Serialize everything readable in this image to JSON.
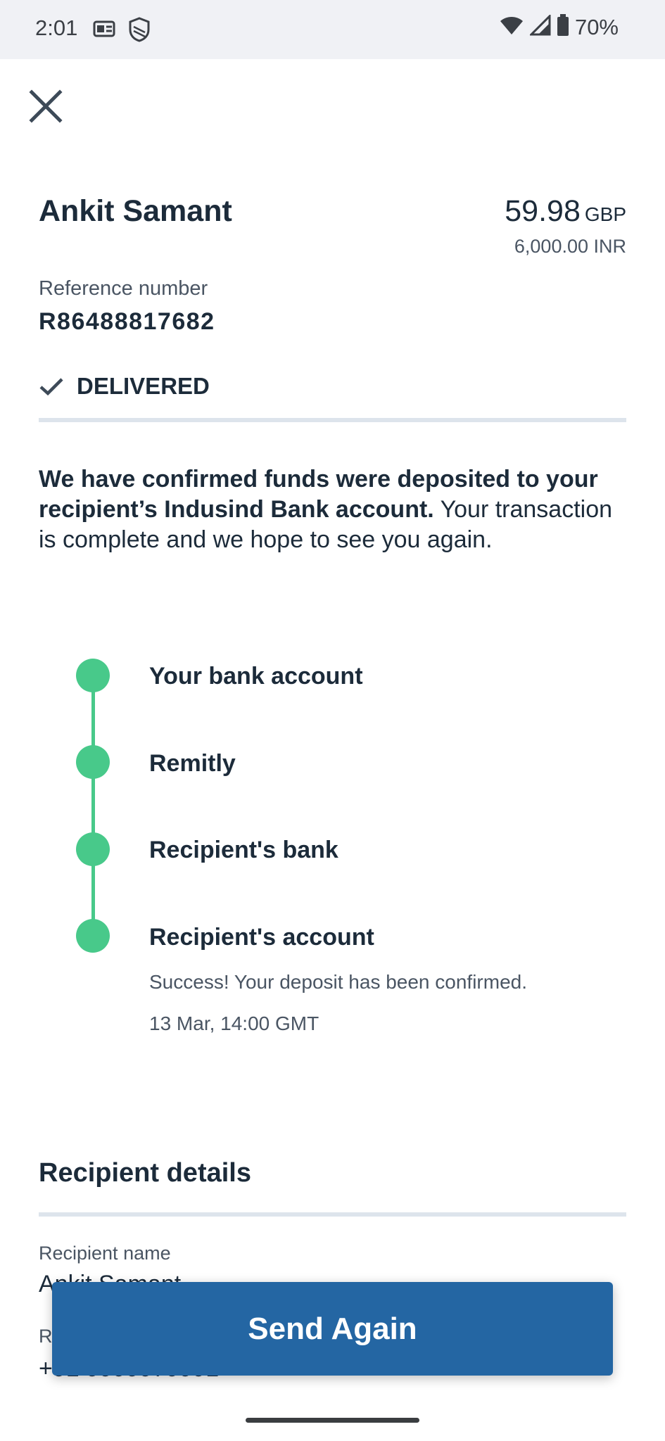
{
  "status_bar": {
    "time": "2:01",
    "battery": "70%"
  },
  "header": {
    "close_icon": "close-icon"
  },
  "transfer": {
    "recipient": "Ankit Samant",
    "amount": "59.98",
    "amount_currency": "GBP",
    "converted": "6,000.00 INR",
    "reference_label": "Reference number",
    "reference_value": "R86488817682",
    "status": "DELIVERED"
  },
  "message": {
    "bold": "We have confirmed funds were deposited to your recipient’s Indusind Bank account.",
    "normal": " Your transaction is complete and we hope to see you again."
  },
  "timeline": {
    "steps": [
      {
        "label": "Your bank account"
      },
      {
        "label": "Remitly"
      },
      {
        "label": "Recipient's bank"
      },
      {
        "label": "Recipient's account"
      }
    ],
    "final_note": "Success! Your deposit has been confirmed.",
    "final_time": "13 Mar, 14:00 GMT",
    "color": "#48c98a"
  },
  "recipient_details": {
    "title": "Recipient details",
    "name_label": "Recipient name",
    "name_value": "Ankit Samant",
    "phone_label": "R",
    "phone_value": "+91 9999979991"
  },
  "actions": {
    "send_again": "Send Again"
  },
  "colors": {
    "primary": "#2466a3",
    "success": "#48c98a",
    "text": "#1c2b3a"
  }
}
